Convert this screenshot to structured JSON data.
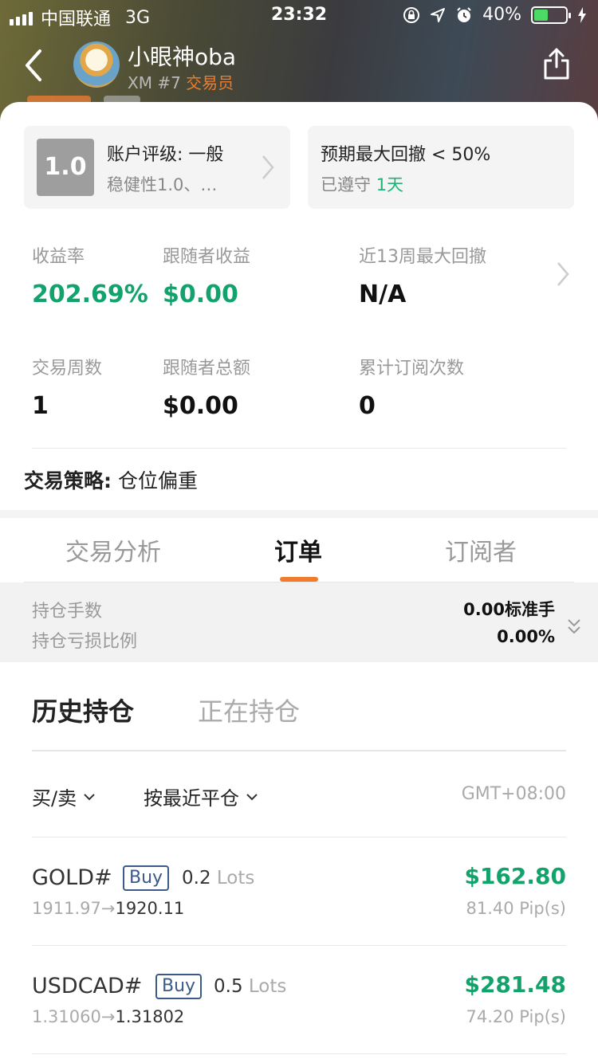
{
  "status_bar": {
    "carrier": "中国联通",
    "network": "3G",
    "time": "23:32",
    "battery": "40%"
  },
  "header": {
    "nickname": "小眼神oba",
    "sub_prefix": "XM #7",
    "role": "交易员"
  },
  "cards": {
    "rating_score": "1.0",
    "rating_title": "账户评级: 一般",
    "rating_desc": "稳健性1.0、…",
    "drawdown_title": "预期最大回撤 < 50%",
    "drawdown_prefix": "已遵守",
    "drawdown_days": "1天"
  },
  "stats": {
    "return_label": "收益率",
    "return_value": "202.69%",
    "follower_profit_label": "跟随者收益",
    "follower_profit_value": "$0.00",
    "max_dd_label": "近13周最大回撤",
    "max_dd_value": "N/A",
    "weeks_label": "交易周数",
    "weeks_value": "1",
    "follower_total_label": "跟随者总额",
    "follower_total_value": "$0.00",
    "subs_label": "累计订阅次数",
    "subs_value": "0"
  },
  "strategy": {
    "label": "交易策略:",
    "value": "仓位偏重"
  },
  "tabs": [
    {
      "label": "交易分析"
    },
    {
      "label": "订单"
    },
    {
      "label": "订阅者"
    }
  ],
  "summary": {
    "lots_label": "持仓手数",
    "lots_value": "0.00标准手",
    "loss_label": "持仓亏损比例",
    "loss_value": "0.00%"
  },
  "history_tabs": {
    "history": "历史持仓",
    "open": "正在持仓"
  },
  "filters": {
    "side": "买/卖",
    "sort": "按最近平仓",
    "timezone": "GMT+08:00"
  },
  "orders": [
    {
      "symbol": "GOLD#",
      "side": "Buy",
      "lots": "0.2",
      "lots_unit": "Lots",
      "open_price": "1911.97",
      "close_price": "1920.11",
      "profit": "$162.80",
      "pips": "81.40 Pip(s)"
    },
    {
      "symbol": "USDCAD#",
      "side": "Buy",
      "lots": "0.5",
      "lots_unit": "Lots",
      "open_price": "1.31060",
      "close_price": "1.31802",
      "profit": "$281.48",
      "pips": "74.20 Pip(s)"
    }
  ],
  "colors": {
    "accent_orange": "#f07b2c",
    "profit_green": "#12a26c",
    "badge_blue": "#3a5a8a"
  }
}
